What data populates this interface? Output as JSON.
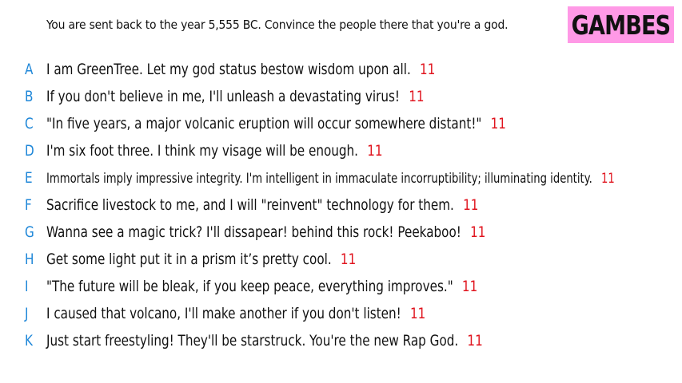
{
  "question": "You are sent back to the year 5,555 BC. Convince the people there that you're a god.",
  "logo": "GAMBES",
  "colors": {
    "letter": "#1f87d8",
    "score": "#e0141e",
    "logo_bg": "#ff99e6"
  },
  "answers": [
    {
      "letter": "A",
      "text": "I am GreenTree. Let my god status bestow wisdom upon all.",
      "score": "11"
    },
    {
      "letter": "B",
      "text": "If you don't believe in me, I'll unleash a devastating virus!",
      "score": "11"
    },
    {
      "letter": "C",
      "text": "\"In five years, a major volcanic eruption will occur somewhere distant!\"",
      "score": "11"
    },
    {
      "letter": "D",
      "text": "I'm six foot three. I think my visage will be enough.",
      "score": "11"
    },
    {
      "letter": "E",
      "text": "Immortals imply impressive integrity. I'm intelligent in immaculate incorruptibility; illuminating identity.",
      "score": "11"
    },
    {
      "letter": "F",
      "text": "Sacrifice livestock to me, and I will \"reinvent\" technology for them.",
      "score": "11"
    },
    {
      "letter": "G",
      "text": "Wanna see a magic trick? I'll dissapear! behind this rock! Peekaboo!",
      "score": "11"
    },
    {
      "letter": "H",
      "text": "Get some light put it in a prism it’s pretty cool.",
      "score": "11"
    },
    {
      "letter": "I",
      "text": "\"The future will be bleak, if you keep peace, everything improves.\"",
      "score": "11"
    },
    {
      "letter": "J",
      "text": "I caused that volcano, I'll make another if you don't listen!",
      "score": "11"
    },
    {
      "letter": "K",
      "text": "Just start freestyling! They'll be starstruck. You're the new Rap God.",
      "score": "11"
    }
  ]
}
